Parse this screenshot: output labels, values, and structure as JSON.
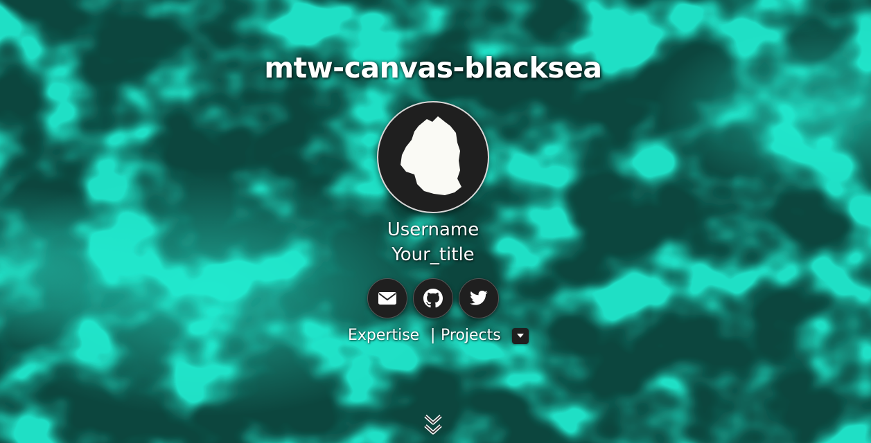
{
  "page": {
    "title": "mtw-canvas-blacksea"
  },
  "profile": {
    "username": "Username",
    "title": "Your_title",
    "avatar_icon": "avatar-silhouette-icon"
  },
  "social": [
    {
      "name": "email",
      "icon": "envelope-icon"
    },
    {
      "name": "github",
      "icon": "github-icon"
    },
    {
      "name": "twitter",
      "icon": "twitter-icon"
    }
  ],
  "nav": {
    "expertise": "Expertise",
    "separator": "|",
    "projects": "Projects",
    "dropdown_icon": "caret-down-icon"
  },
  "scroll": {
    "icon": "double-chevron-down-icon"
  },
  "colors": {
    "background": "#0d4a42",
    "caustic_highlight": "#1fe8cf",
    "button_bg": "#1f1f1f",
    "text": "#ffffff"
  }
}
